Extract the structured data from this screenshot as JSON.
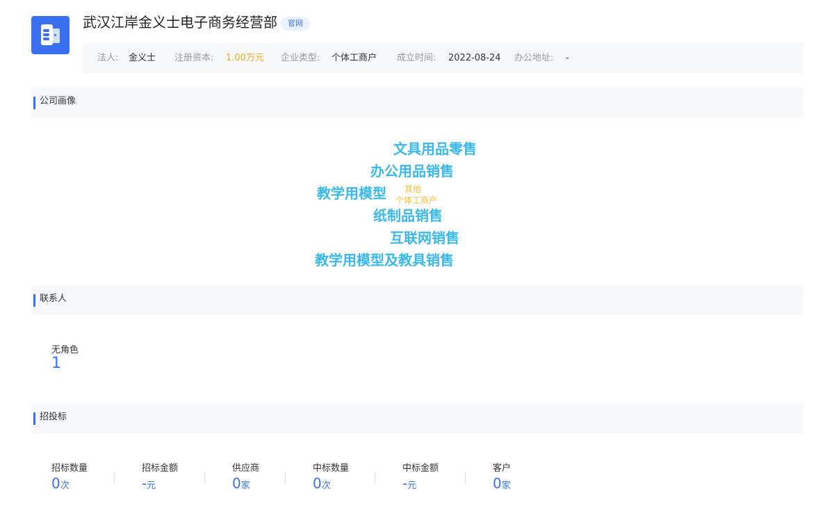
{
  "company": {
    "name": "武汉江岸金义士电子商务经营部",
    "badge": "官网",
    "logo_icon": "building-doc-icon",
    "accent_color": "#3a6ff0"
  },
  "info": {
    "legal_rep_label": "法人:",
    "legal_rep": "金义士",
    "capital_label": "注册资本:",
    "capital": "1.00万元",
    "type_label": "企业类型:",
    "type": "个体工商户",
    "founded_label": "成立时间:",
    "founded": "2022-08-24",
    "address_label": "办公地址:",
    "address": "-"
  },
  "portrait": {
    "title": "公司画像",
    "words": [
      "文具用品零售",
      "办公用品销售",
      "教学用模型",
      "其他",
      "个体工商户",
      "纸制品销售",
      "互联网销售",
      "教学用模型及教具销售"
    ]
  },
  "contacts": {
    "title": "联系人",
    "role_label": "无角色",
    "role_count": "1"
  },
  "bidding": {
    "title": "招投标",
    "stats": [
      {
        "label": "招标数量",
        "value": "0",
        "unit": "次"
      },
      {
        "label": "招标金额",
        "value": "-",
        "unit": "元"
      },
      {
        "label": "供应商",
        "value": "0",
        "unit": "家"
      },
      {
        "label": "中标数量",
        "value": "0",
        "unit": "次"
      },
      {
        "label": "中标金额",
        "value": "-",
        "unit": "元"
      },
      {
        "label": "客户",
        "value": "0",
        "unit": "家"
      }
    ]
  }
}
